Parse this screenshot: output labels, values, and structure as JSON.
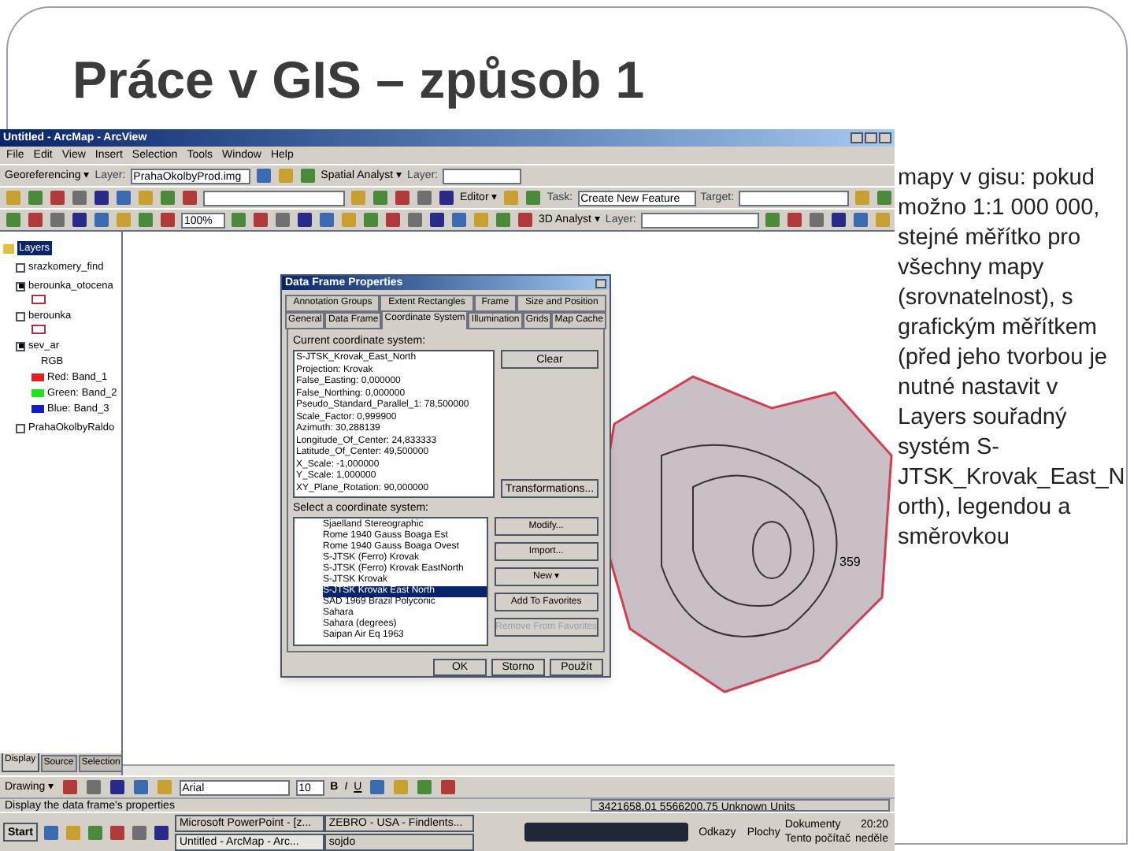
{
  "slide": {
    "title": "Práce v GIS – způsob 1",
    "note": "mapy v gisu: pokud možno 1:1 000 000, stejné měřítko pro všechny mapy (srovnatelnost), s grafickým měřítkem (před jeho tvorbou je nutné nastavit v Layers souřadný systém S-JTSK_Krovak_East_North), legendou a směrovkou"
  },
  "app": {
    "title": "Untitled - ArcMap - ArcView",
    "menu": [
      "File",
      "Edit",
      "View",
      "Insert",
      "Selection",
      "Tools",
      "Window",
      "Help"
    ],
    "toolbar_rows": [
      [
        {
          "kind": "menu",
          "text": "Georeferencing ▾"
        },
        {
          "kind": "label",
          "text": "Layer:"
        },
        {
          "kind": "combo",
          "text": "PrahaOkolbyProd.img"
        },
        {
          "kind": "menu",
          "text": "Spatial Analyst ▾"
        },
        {
          "kind": "label",
          "text": "Layer:"
        },
        {
          "kind": "combo",
          "text": ""
        }
      ],
      [
        {
          "kind": "combo",
          "text": ""
        },
        {
          "kind": "menu",
          "text": "Editor ▾"
        },
        {
          "kind": "label",
          "text": "Task:"
        },
        {
          "kind": "combo",
          "text": "Create New Feature"
        },
        {
          "kind": "label",
          "text": "Target:"
        },
        {
          "kind": "combo",
          "text": ""
        }
      ],
      [
        {
          "kind": "combo",
          "text": "100%"
        },
        {
          "kind": "menu",
          "text": "3D Analyst ▾"
        },
        {
          "kind": "label",
          "text": "Layer:"
        },
        {
          "kind": "combo",
          "text": ""
        }
      ]
    ],
    "toc": {
      "root": "Layers",
      "layers": [
        {
          "name": "srazkomery_find",
          "checked": false,
          "legend": [
            {
              "kind": "none"
            }
          ]
        },
        {
          "name": "berounka_otocena",
          "checked": true,
          "legend": [
            {
              "kind": "outline"
            }
          ]
        },
        {
          "name": "berounka",
          "checked": false,
          "legend": [
            {
              "kind": "outline"
            }
          ]
        },
        {
          "name": "sev_ar",
          "checked": true,
          "legend": [
            {
              "kind": "text",
              "label": "RGB"
            },
            {
              "kind": "swatch",
              "color": "#e02020",
              "label": "Red:",
              "value": "Band_1"
            },
            {
              "kind": "swatch",
              "color": "#20e020",
              "label": "Green:",
              "value": "Band_2"
            },
            {
              "kind": "swatch",
              "color": "#1020c0",
              "label": "Blue:",
              "value": "Band_3"
            }
          ]
        },
        {
          "name": "PrahaOkolbyRaldo",
          "checked": false,
          "legend": [
            {
              "kind": "none"
            }
          ]
        }
      ],
      "tabs": [
        {
          "label": "Display",
          "selected": true
        },
        {
          "label": "Source",
          "selected": false
        },
        {
          "label": "Selection",
          "selected": false
        }
      ]
    },
    "map_labels": [
      "359"
    ],
    "dialog": {
      "title": "Data Frame Properties",
      "tabs_back": [
        {
          "label": "Annotation Groups",
          "selected": false
        },
        {
          "label": "Extent Rectangles",
          "selected": false
        },
        {
          "label": "Frame",
          "selected": false
        },
        {
          "label": "Size and Position",
          "selected": false
        }
      ],
      "tabs_front": [
        {
          "label": "General",
          "selected": false
        },
        {
          "label": "Data Frame",
          "selected": false
        },
        {
          "label": "Coordinate System",
          "selected": true
        },
        {
          "label": "Illumination",
          "selected": false
        },
        {
          "label": "Grids",
          "selected": false
        },
        {
          "label": "Map Cache",
          "selected": false
        }
      ],
      "current_label": "Current coordinate system:",
      "current": [
        "S-JTSK_Krovak_East_North",
        "Projection: Krovak",
        "False_Easting: 0,000000",
        "False_Northing: 0,000000",
        "Pseudo_Standard_Parallel_1: 78,500000",
        "Scale_Factor: 0,999900",
        "Azimuth: 30,288139",
        "Longitude_Of_Center: 24,833333",
        "Latitude_Of_Center: 49,500000",
        "X_Scale: -1,000000",
        "Y_Scale: 1,000000",
        "XY_Plane_Rotation: 90,000000"
      ],
      "side_buttons_top": [
        {
          "label": "Clear",
          "disabled": false
        },
        {
          "label": "Transformations...",
          "disabled": false
        }
      ],
      "select_label": "Select a coordinate system:",
      "systems": [
        {
          "name": "Sjaelland Stereographic",
          "selected": false
        },
        {
          "name": "Rome 1940 Gauss Boaga Est",
          "selected": false
        },
        {
          "name": "Rome 1940 Gauss Boaga Ovest",
          "selected": false
        },
        {
          "name": "S-JTSK (Ferro) Krovak",
          "selected": false
        },
        {
          "name": "S-JTSK (Ferro) Krovak EastNorth",
          "selected": false
        },
        {
          "name": "S-JTSK Krovak",
          "selected": false
        },
        {
          "name": "S-JTSK Krovak East North",
          "selected": true
        },
        {
          "name": "SAD 1969 Brazil Polyconic",
          "selected": false
        },
        {
          "name": "Sahara",
          "selected": false
        },
        {
          "name": "Sahara (degrees)",
          "selected": false
        },
        {
          "name": "Saipan Air Eq 1963",
          "selected": false
        }
      ],
      "side_buttons": [
        {
          "label": "Modify...",
          "disabled": false
        },
        {
          "label": "Import...",
          "disabled": false
        },
        {
          "label": "New ▾",
          "disabled": false
        },
        {
          "label": "Add To Favorites",
          "disabled": false
        },
        {
          "label": "Remove From Favorites",
          "disabled": true
        }
      ],
      "buttons": [
        "OK",
        "Storno",
        "Použít"
      ]
    },
    "drawing_toolbar": {
      "menu": "Drawing ▾",
      "font": "Arial",
      "size": "10",
      "styles": [
        "B",
        "I",
        "U"
      ]
    },
    "status": {
      "message": "Display the data frame's properties",
      "coords": "3421658.01  5566200.75 Unknown Units"
    },
    "taskbar": {
      "start": "Start",
      "tasks": [
        "Microsoft PowerPoint - [z...",
        "ZEBRO - USA - Findlents...",
        "Untitled - ArcMap - Arc...",
        "sojdo"
      ],
      "toolbars": [
        "Odkazy",
        "Plochy"
      ],
      "places": [
        "Dokumenty",
        "Tento počítač"
      ],
      "clock": "20:20",
      "day": "neděle"
    }
  }
}
